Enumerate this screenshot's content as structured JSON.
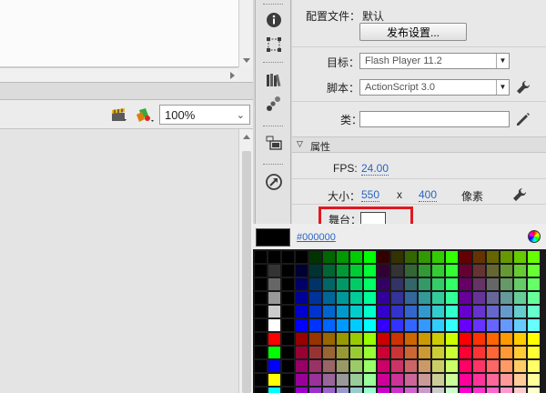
{
  "zoom": {
    "value": "100%"
  },
  "properties": {
    "profile_label": "配置文件：",
    "profile_value": "默认",
    "publish_button": "发布设置...",
    "target_label": "目标：",
    "target_value": "Flash Player 11.2",
    "script_label": "脚本：",
    "script_value": "ActionScript 3.0",
    "class_label": "类：",
    "class_value": "",
    "section_title": "属性",
    "fps_label": "FPS:",
    "fps_value": "24.00",
    "size_label": "大小：",
    "width_value": "550",
    "size_sep": "x",
    "height_value": "400",
    "unit_label": "像素",
    "stage_label": "舞台：",
    "stage_color": "#ffffff"
  },
  "color_picker": {
    "current_hex": "#000000"
  },
  "colors": {
    "highlight": "#e0181f",
    "link": "#2a64c5"
  },
  "icons": [
    "info-icon",
    "transform-icon",
    "library-icon",
    "motion-presets-icon",
    "components-icon",
    "movie-explorer-icon",
    "clapper-icon",
    "color-icon",
    "wrench-icon",
    "pencil-icon",
    "color-wheel-icon"
  ]
}
